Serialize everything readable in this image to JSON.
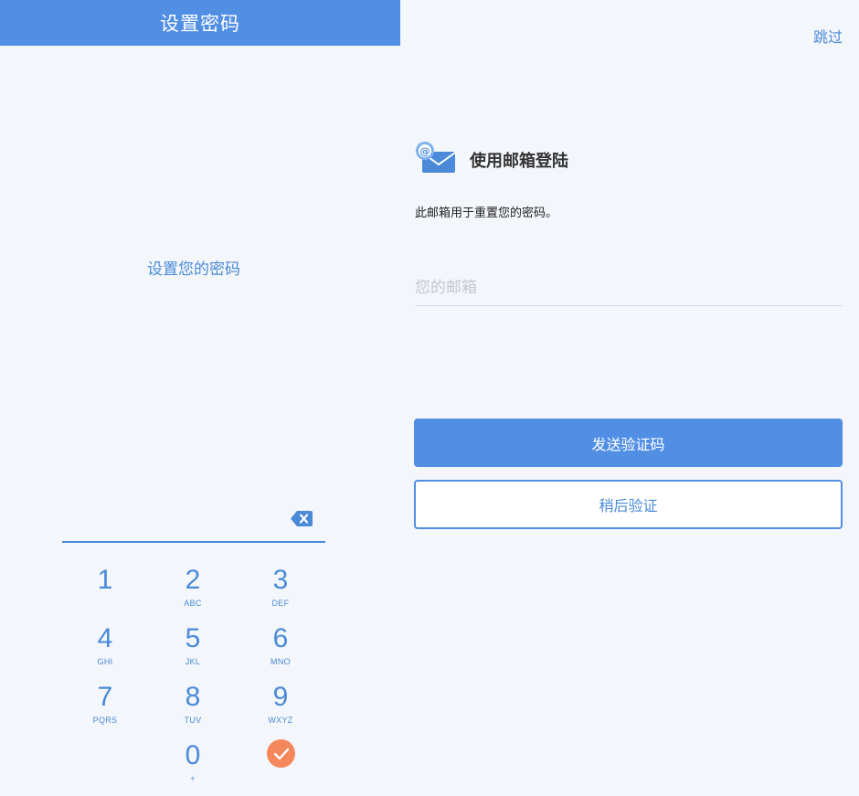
{
  "left": {
    "title": "设置密码",
    "prompt": "设置您的密码",
    "keypad": [
      {
        "digit": "1",
        "letters": ""
      },
      {
        "digit": "2",
        "letters": "ABC"
      },
      {
        "digit": "3",
        "letters": "DEF"
      },
      {
        "digit": "4",
        "letters": "GHI"
      },
      {
        "digit": "5",
        "letters": "JKL"
      },
      {
        "digit": "6",
        "letters": "MNO"
      },
      {
        "digit": "7",
        "letters": "PQRS"
      },
      {
        "digit": "8",
        "letters": "TUV"
      },
      {
        "digit": "9",
        "letters": "WXYZ"
      },
      {
        "digit": "0",
        "letters": "+"
      }
    ],
    "backspace_icon": "backspace-icon",
    "confirm_icon": "check-icon"
  },
  "right": {
    "skip": "跳过",
    "title": "使用邮箱登陆",
    "description": "此邮箱用于重置您的密码。",
    "email_placeholder": "您的邮箱",
    "email_value": "",
    "send_button": "发送验证码",
    "later_button": "稍后验证",
    "mail_icon": "email-icon"
  },
  "colors": {
    "primary": "#518fe5",
    "accent_text": "#4a8ad8",
    "confirm": "#f5875c",
    "background": "#f3f6fa"
  }
}
